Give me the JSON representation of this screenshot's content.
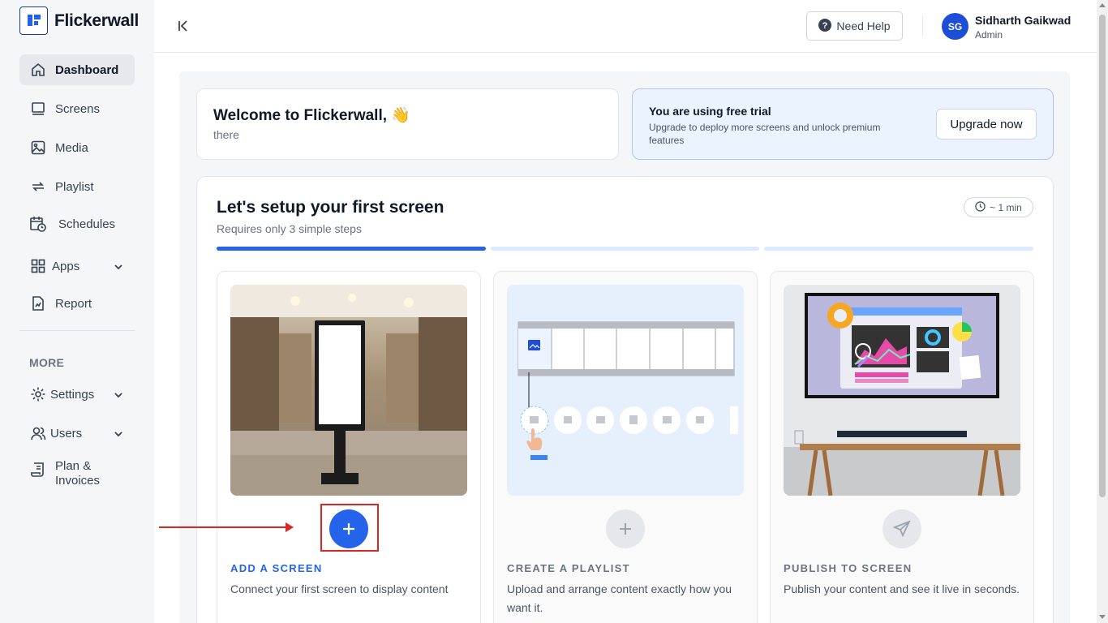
{
  "brand": {
    "name": "Flickerwall"
  },
  "sidebar": {
    "items": [
      {
        "label": "Dashboard",
        "icon": "home-icon",
        "active": true
      },
      {
        "label": "Screens",
        "icon": "screens-icon"
      },
      {
        "label": "Media",
        "icon": "image-icon"
      },
      {
        "label": "Playlist",
        "icon": "repeat-icon"
      },
      {
        "label": "Schedules",
        "icon": "calendar-clock-icon"
      },
      {
        "label": "Apps",
        "icon": "grid-icon",
        "expandable": true
      },
      {
        "label": "Report",
        "icon": "report-icon"
      }
    ],
    "more_label": "MORE",
    "more_items": [
      {
        "label": "Settings",
        "icon": "gear-icon",
        "expandable": true
      },
      {
        "label": "Users",
        "icon": "users-icon",
        "expandable": true
      },
      {
        "label": "Plan & Invoices",
        "icon": "invoice-icon"
      }
    ]
  },
  "topbar": {
    "help_label": "Need Help",
    "user": {
      "initials": "SG",
      "name": "Sidharth Gaikwad",
      "role": "Admin"
    }
  },
  "welcome": {
    "title": "Welcome to Flickerwall, 👋",
    "subtitle": "there"
  },
  "trial": {
    "title": "You are using free trial",
    "description": "Upgrade to deploy more screens and unlock premium features",
    "button_label": "Upgrade now"
  },
  "setup": {
    "title": "Let's setup your first screen",
    "subtitle": "Requires only 3 simple steps",
    "time_label": "~ 1 min",
    "progress": [
      1,
      0,
      0
    ],
    "steps": [
      {
        "title": "ADD A SCREEN",
        "description": "Connect your first screen to display content",
        "status": "active"
      },
      {
        "title": "CREATE A PLAYLIST",
        "description": "Upload and arrange content exactly how you want it.",
        "status": "pending"
      },
      {
        "title": "PUBLISH TO SCREEN",
        "description": "Publish your content and see it live in seconds.",
        "status": "pending"
      }
    ]
  },
  "colors": {
    "accent": "#2563eb",
    "accent_light": "#dbeafe",
    "annotation": "#dc2626",
    "muted_button": "#e5e7eb"
  }
}
